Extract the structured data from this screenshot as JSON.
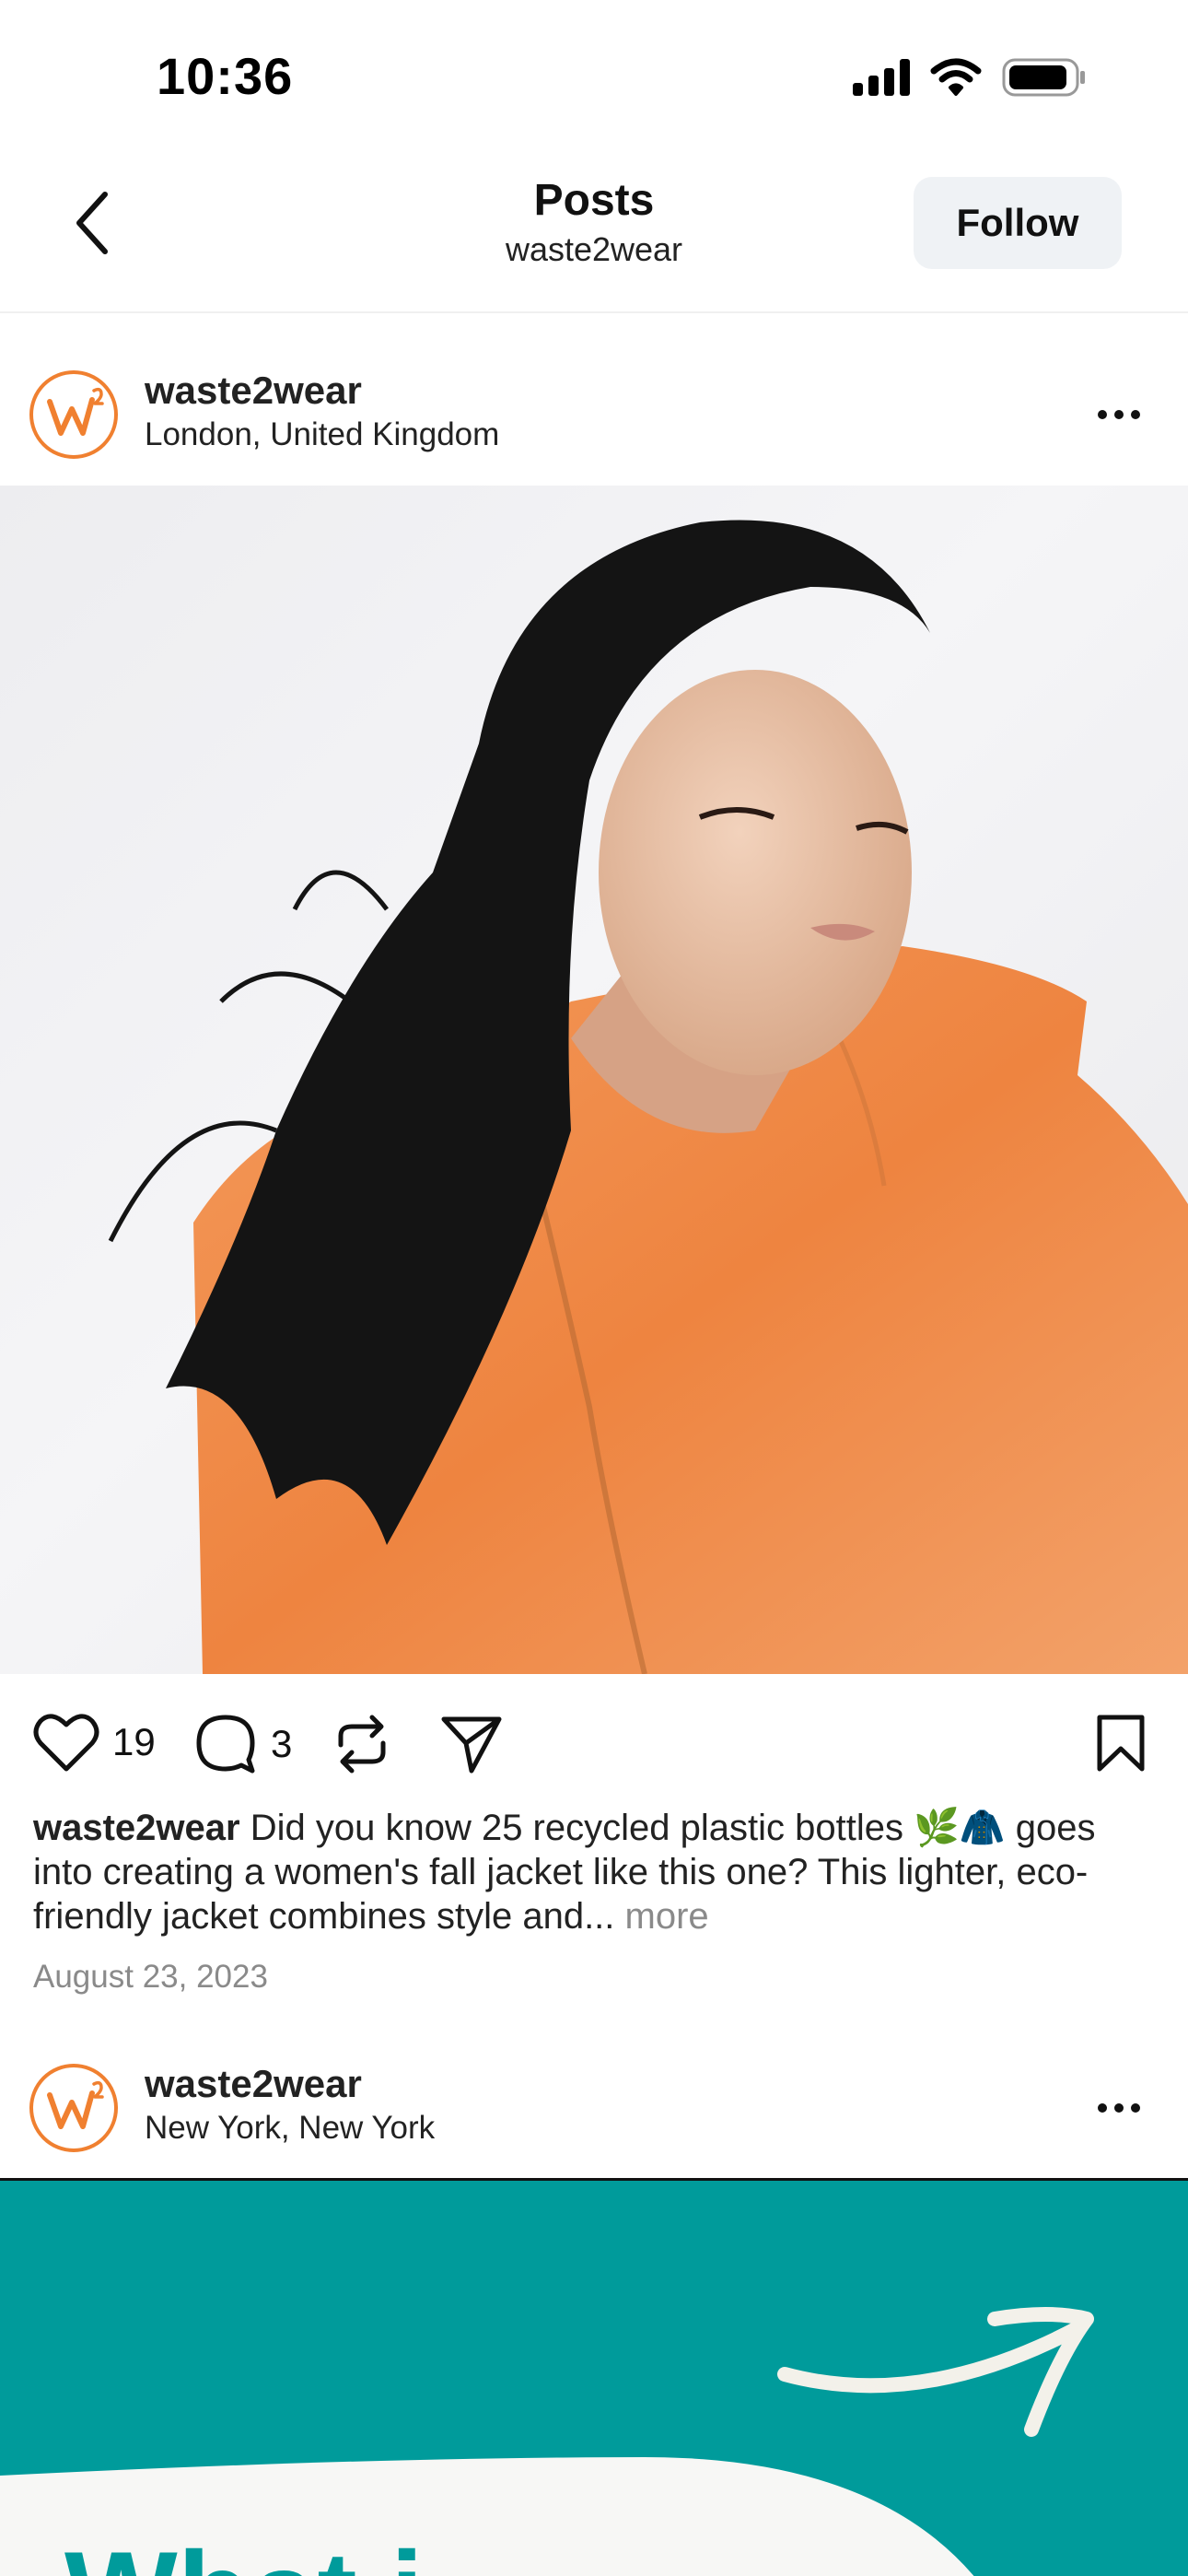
{
  "status_bar": {
    "time": "10:36"
  },
  "header": {
    "title": "Posts",
    "subtitle": "waste2wear",
    "follow_label": "Follow"
  },
  "post1": {
    "username": "waste2wear",
    "location": "London, United Kingdom",
    "likes": "19",
    "comments": "3",
    "caption_user": "waste2wear",
    "caption_text": "Did you know  25 recycled plastic bottles 🌿🧥 goes into creating a women's fall jacket like this one? This lighter, eco-friendly jacket combines style and...",
    "caption_more": "more",
    "date": "August 23, 2023"
  },
  "post2": {
    "username": "waste2wear",
    "location": "New York, New York",
    "partial_text": "What i"
  },
  "colors": {
    "accent_orange": "#f08030",
    "teal": "#009b9b",
    "follow_bg": "#eff2f5"
  },
  "icons": [
    "back-chevron-icon",
    "heart-icon",
    "comment-icon",
    "repost-icon",
    "share-icon",
    "bookmark-icon",
    "more-icon",
    "signal-icon",
    "wifi-icon",
    "battery-icon"
  ]
}
